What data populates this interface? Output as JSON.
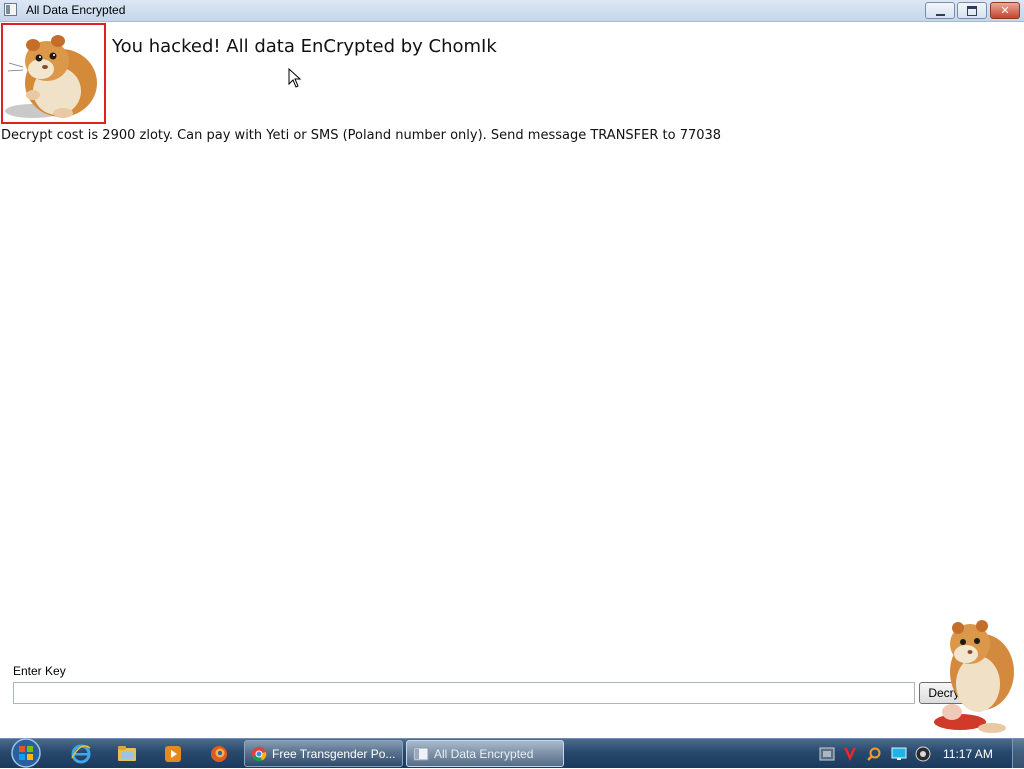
{
  "window": {
    "title": "All Data Encrypted",
    "controls": {
      "minimize": "minimize",
      "maximize": "restore",
      "close": "close"
    }
  },
  "content": {
    "headline": "You hacked! All data EnCrypted by ChomIk",
    "cost_message": "Decrypt cost is 2900 zloty. Can pay with Yeti or SMS (Poland number only). Send message TRANSFER to 77038",
    "key_label": "Enter Key",
    "key_value": "",
    "decrypt_button": "Decrypt",
    "accent_color": "#e02020"
  },
  "taskbar": {
    "quick_launch": [
      "internet-explorer-icon",
      "folder-icon",
      "media-player-icon",
      "firefox-icon"
    ],
    "tasks": [
      {
        "label": "Free Transgender Po...",
        "icon": "chrome-icon",
        "active": false
      },
      {
        "label": "All Data Encrypted",
        "icon": "window-icon",
        "active": true
      }
    ],
    "tray": [
      "network-icon",
      "antivirus-icon",
      "search-icon",
      "display-icon",
      "volume-icon"
    ],
    "clock": "11:17 AM"
  }
}
